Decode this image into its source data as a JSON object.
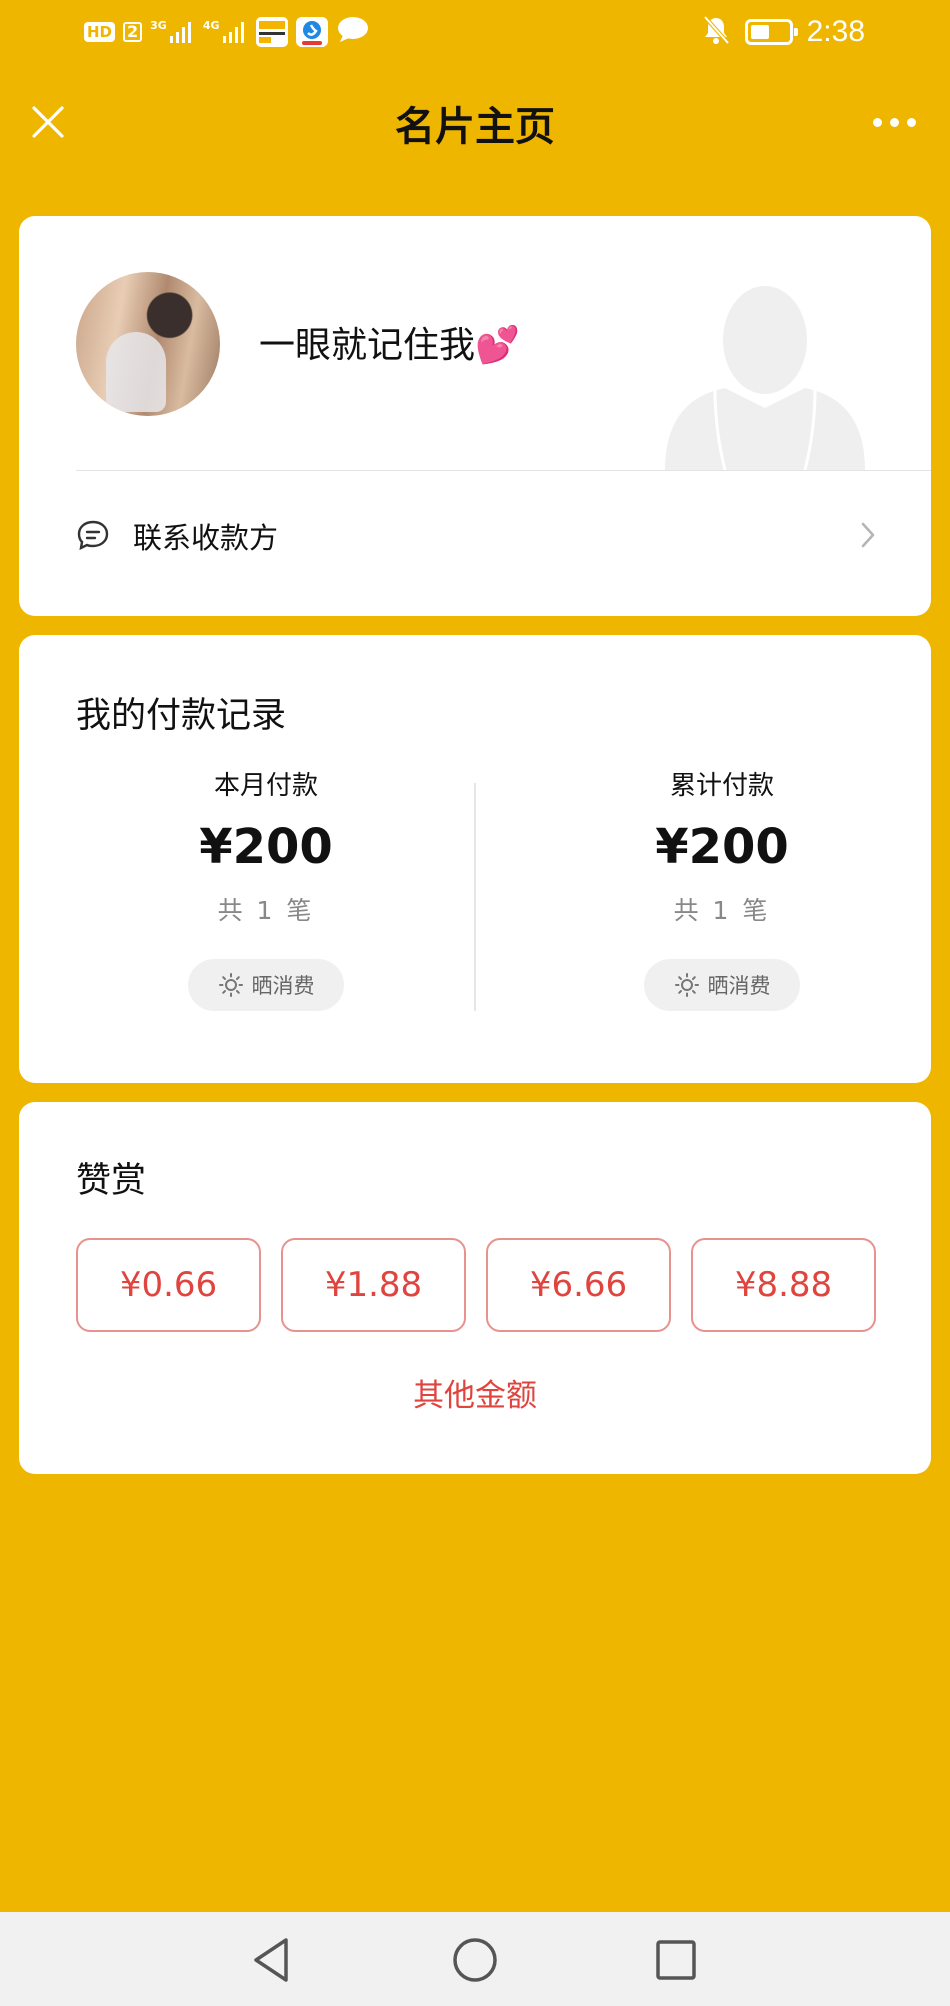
{
  "status_bar": {
    "hd_label": "HD",
    "sim_label": "2",
    "net1_label": "3G",
    "net2_label": "4G",
    "time": "2:38",
    "battery_level_pct": 50,
    "icons": [
      "signal-icon",
      "signal-icon",
      "app-notification-icon",
      "browser-app-icon",
      "chat-bubble-icon",
      "bell-muted-icon",
      "battery-icon"
    ]
  },
  "header": {
    "title": "名片主页",
    "close_icon": "close-icon",
    "more_icon": "more-icon"
  },
  "profile": {
    "name": "一眼就记住我💕",
    "contact_label": "联系收款方"
  },
  "payment": {
    "title": "我的付款记录",
    "month": {
      "label": "本月付款",
      "amount": "¥200",
      "count": "共 1 笔",
      "share_label": "晒消费"
    },
    "total": {
      "label": "累计付款",
      "amount": "¥200",
      "count": "共 1 笔",
      "share_label": "晒消费"
    }
  },
  "tip": {
    "title": "赞赏",
    "amounts": [
      "¥0.66",
      "¥1.88",
      "¥6.66",
      "¥8.88"
    ],
    "other_label": "其他金额"
  },
  "colors": {
    "background": "#EFB600",
    "accent_red": "#E0443E",
    "card": "#FFFFFF"
  }
}
